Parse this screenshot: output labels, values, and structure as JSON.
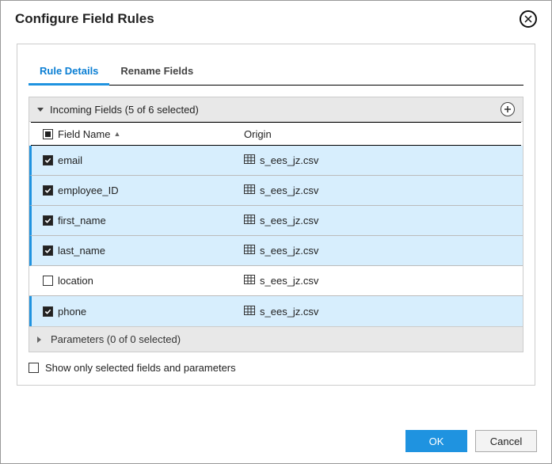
{
  "title": "Configure Field Rules",
  "tabs": {
    "rule_details": "Rule Details",
    "rename_fields": "Rename Fields"
  },
  "section": {
    "incoming_label": "Incoming Fields (5 of 6 selected)",
    "params_label": "Parameters (0 of 0 selected)"
  },
  "columns": {
    "field_name": "Field Name",
    "origin": "Origin"
  },
  "rows": [
    {
      "name": "email",
      "origin": "s_ees_jz.csv",
      "checked": true
    },
    {
      "name": "employee_ID",
      "origin": "s_ees_jz.csv",
      "checked": true
    },
    {
      "name": "first_name",
      "origin": "s_ees_jz.csv",
      "checked": true
    },
    {
      "name": "last_name",
      "origin": "s_ees_jz.csv",
      "checked": true
    },
    {
      "name": "location",
      "origin": "s_ees_jz.csv",
      "checked": false
    },
    {
      "name": "phone",
      "origin": "s_ees_jz.csv",
      "checked": true
    }
  ],
  "show_only_label": "Show only selected fields and parameters",
  "show_only_checked": false,
  "buttons": {
    "ok": "OK",
    "cancel": "Cancel"
  }
}
